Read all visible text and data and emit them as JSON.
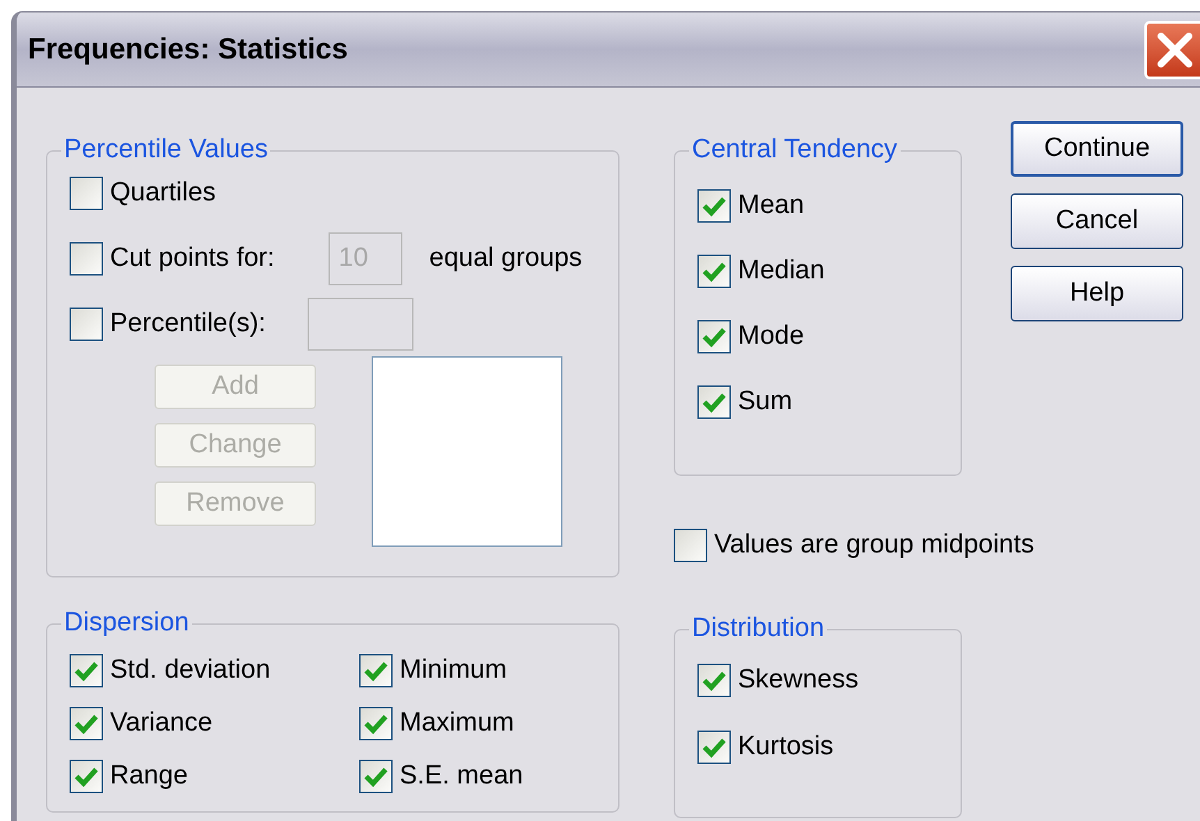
{
  "window": {
    "title": "Frequencies: Statistics"
  },
  "percentile_values": {
    "title": "Percentile Values",
    "options": [
      {
        "kind": "plain",
        "label": "Quartiles",
        "checked": false
      },
      {
        "kind": "cut",
        "label": "Cut points for:",
        "checked": false,
        "value": "10",
        "suffix": "equal groups"
      },
      {
        "kind": "entry",
        "label": "Percentile(s):",
        "checked": false
      }
    ],
    "buttons": [
      {
        "label": "Add",
        "disabled": true
      },
      {
        "label": "Change",
        "disabled": true
      },
      {
        "label": "Remove",
        "disabled": true
      }
    ]
  },
  "central_tendency": {
    "title": "Central Tendency",
    "items": [
      {
        "label": "Mean",
        "checked": true
      },
      {
        "label": "Median",
        "checked": true
      },
      {
        "label": "Mode",
        "checked": true
      },
      {
        "label": "Sum",
        "checked": true
      }
    ]
  },
  "group_midpoints": {
    "label": "Values are group midpoints",
    "checked": false
  },
  "buttons": [
    {
      "label": "Continue",
      "default": true
    },
    {
      "label": "Cancel",
      "default": false
    },
    {
      "label": "Help",
      "default": false
    }
  ],
  "dispersion": {
    "title": "Dispersion",
    "items": [
      {
        "label": "Std. deviation",
        "checked": true
      },
      {
        "label": "Minimum",
        "checked": true
      },
      {
        "label": "Variance",
        "checked": true
      },
      {
        "label": "Maximum",
        "checked": true
      },
      {
        "label": "Range",
        "checked": true
      },
      {
        "label": "S.E. mean",
        "checked": true
      }
    ]
  },
  "distribution": {
    "title": "Distribution",
    "items": [
      {
        "label": "Skewness",
        "checked": true
      },
      {
        "label": "Kurtosis",
        "checked": true
      }
    ]
  }
}
